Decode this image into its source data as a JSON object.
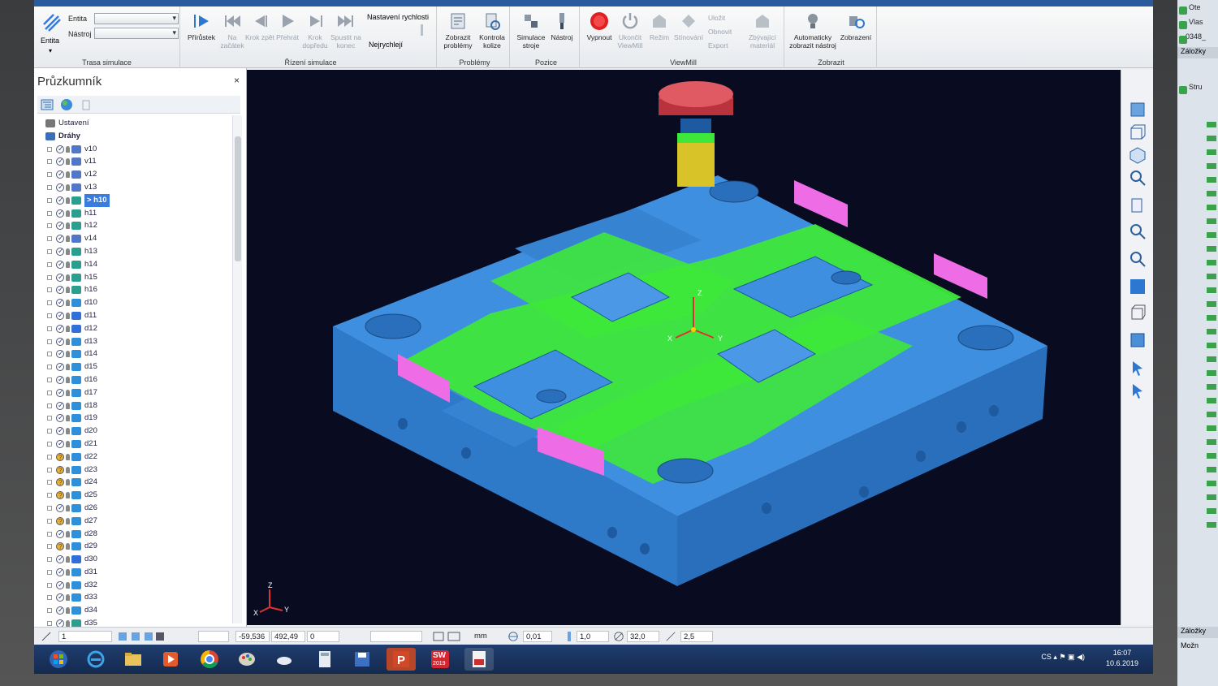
{
  "ribbon": {
    "trasa": {
      "entita_label": "Entita",
      "nastroj_label": "Nástroj",
      "entita_button": "Entita",
      "title": "Trasa simulace"
    },
    "rizeni": {
      "buttons": [
        "Přírůstek",
        "Na začátek",
        "Krok zpět",
        "Přehrát",
        "Krok dopředu",
        "Spustit na konec"
      ],
      "speed_label": "Nastavení rychlosti",
      "speed_value": "Nejrychlejí",
      "title": "Řízení simulace"
    },
    "problemy": {
      "buttons": [
        "Zobrazit problémy",
        "Kontrola kolize"
      ],
      "title": "Problémy"
    },
    "pozice": {
      "buttons": [
        "Simulace stroje",
        "Nástroj"
      ],
      "title": "Pozice"
    },
    "viewmill": {
      "buttons": [
        "Vypnout",
        "Ukončit ViewMill",
        "Režim",
        "Stínování"
      ],
      "small": [
        "Uložit",
        "Obnovit",
        "Export"
      ],
      "zbyvajici": "Zbývající materiál",
      "title": "ViewMill"
    },
    "zobrazit": {
      "buttons": [
        "Automaticky zobrazit nástroj",
        "Zobrazení"
      ],
      "title": "Zobrazit"
    }
  },
  "explorer": {
    "title": "Průzkumník",
    "close": "×",
    "tree": [
      {
        "label": "Ustavení",
        "state": "none",
        "icon": "setup",
        "indent": 0
      },
      {
        "label": "Dráhy",
        "state": "none",
        "icon": "folder",
        "indent": 0,
        "bold": true
      },
      {
        "label": "v10",
        "state": "ok",
        "icon": "drill"
      },
      {
        "label": "v11",
        "state": "ok",
        "icon": "drill"
      },
      {
        "label": "v12",
        "state": "ok",
        "icon": "drill"
      },
      {
        "label": "v13",
        "state": "ok",
        "icon": "drill"
      },
      {
        "label": "> h10",
        "state": "ok",
        "icon": "layer",
        "selected": true
      },
      {
        "label": "h11",
        "state": "ok",
        "icon": "layer"
      },
      {
        "label": "h12",
        "state": "ok",
        "icon": "layer"
      },
      {
        "label": "v14",
        "state": "ok",
        "icon": "drill"
      },
      {
        "label": "h13",
        "state": "ok",
        "icon": "layer"
      },
      {
        "label": "h14",
        "state": "ok",
        "icon": "layer"
      },
      {
        "label": "h15",
        "state": "ok",
        "icon": "layer"
      },
      {
        "label": "h16",
        "state": "ok",
        "icon": "layer"
      },
      {
        "label": "d10",
        "state": "ok",
        "icon": "cyl"
      },
      {
        "label": "d11",
        "state": "ok",
        "icon": "drill2"
      },
      {
        "label": "d12",
        "state": "ok",
        "icon": "drill2"
      },
      {
        "label": "d13",
        "state": "ok",
        "icon": "cyl"
      },
      {
        "label": "d14",
        "state": "ok",
        "icon": "cyl"
      },
      {
        "label": "d15",
        "state": "ok",
        "icon": "cyl"
      },
      {
        "label": "d16",
        "state": "ok",
        "icon": "cyl"
      },
      {
        "label": "d17",
        "state": "ok",
        "icon": "cyl"
      },
      {
        "label": "d18",
        "state": "ok",
        "icon": "cyl"
      },
      {
        "label": "d19",
        "state": "ok",
        "icon": "cyl"
      },
      {
        "label": "d20",
        "state": "ok",
        "icon": "cyl"
      },
      {
        "label": "d21",
        "state": "ok",
        "icon": "cyl"
      },
      {
        "label": "d22",
        "state": "warn",
        "icon": "cyl"
      },
      {
        "label": "d23",
        "state": "warn",
        "icon": "cyl"
      },
      {
        "label": "d24",
        "state": "warn",
        "icon": "cyl"
      },
      {
        "label": "d25",
        "state": "warn",
        "icon": "cyl"
      },
      {
        "label": "d26",
        "state": "ok",
        "icon": "cyl"
      },
      {
        "label": "d27",
        "state": "warn",
        "icon": "cyl"
      },
      {
        "label": "d28",
        "state": "ok",
        "icon": "cyl"
      },
      {
        "label": "d29",
        "state": "warn",
        "icon": "cyl"
      },
      {
        "label": "d30",
        "state": "ok",
        "icon": "drill2"
      },
      {
        "label": "d31",
        "state": "ok",
        "icon": "cyl"
      },
      {
        "label": "d32",
        "state": "ok",
        "icon": "cyl"
      },
      {
        "label": "d33",
        "state": "ok",
        "icon": "cyl"
      },
      {
        "label": "d34",
        "state": "ok",
        "icon": "cyl"
      },
      {
        "label": "d35",
        "state": "ok",
        "icon": "layer"
      }
    ]
  },
  "viewport": {
    "axis": {
      "x": "X",
      "y": "Y",
      "z": "Z"
    },
    "close": "×"
  },
  "status": {
    "layer": "1",
    "x": "-59,536",
    "y": "492,49",
    "z": "0",
    "units": "mm",
    "tolerance": "0,01",
    "val1": "1,0",
    "val2": "32,0",
    "val3": "2,5"
  },
  "taskbar": {
    "lang": "CS",
    "time": "16:07",
    "date": "10.6.2019",
    "apps": [
      "start",
      "ie",
      "explorer",
      "media",
      "chrome",
      "paint",
      "cloud",
      "calc",
      "save",
      "powerpoint",
      "solidworks",
      "pdf"
    ],
    "sw_label": "SW",
    "sw_year": "2019"
  },
  "right_monitor": {
    "items": [
      "Ote",
      "Vlas",
      "0348_"
    ],
    "zalozky": "Záložky",
    "stru": "Stru",
    "bottom_zalozky": "Záložky",
    "mozn": "Možn"
  },
  "colors": {
    "model_blue": "#3f8fe0",
    "model_side": "#2f79c9",
    "model_dark": "#1e5aa0",
    "toolpath_green": "#3ee83a",
    "collision_magenta": "#ee6de6",
    "holder_red": "#d9404a",
    "cutter_yellow": "#d8c428",
    "viewport_bg": "#090c20",
    "selection": "#3a7be0"
  }
}
